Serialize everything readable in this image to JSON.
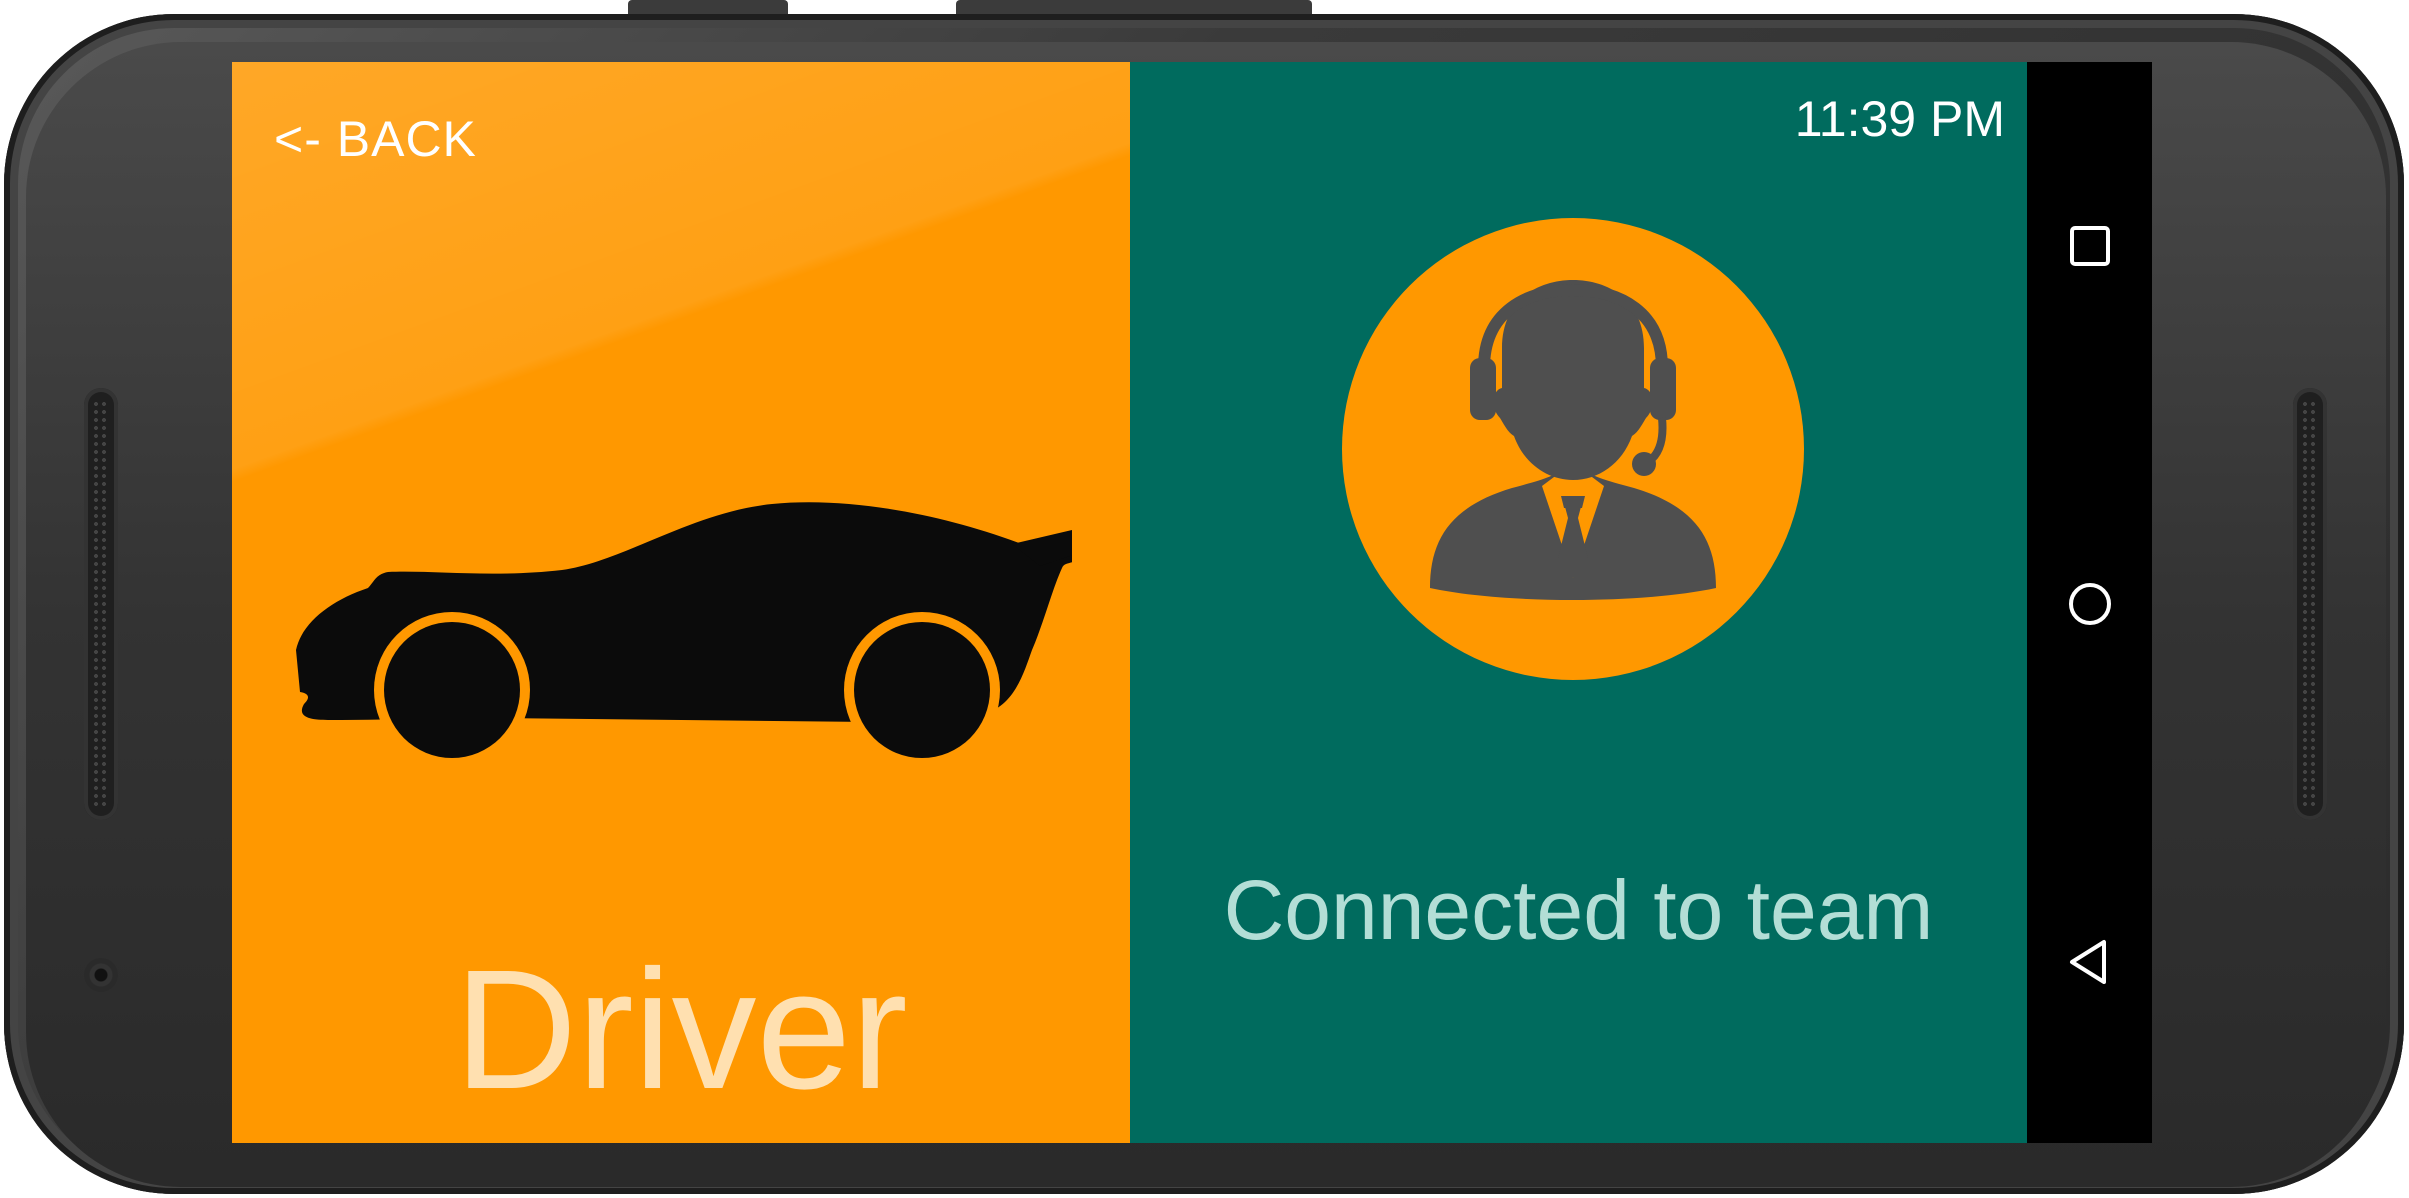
{
  "app": {
    "driver_panel": {
      "back_label": "<- BACK",
      "role_title": "Driver",
      "icon": "race-car-icon",
      "bg_color": "#ff9800"
    },
    "team_panel": {
      "clock": "11:39 PM",
      "status": "Connected to team",
      "icon": "support-agent-headset-icon",
      "bg_color": "#006b5e"
    }
  },
  "nav_bar": {
    "buttons": [
      "recent-apps-icon",
      "home-icon",
      "back-triangle-icon"
    ]
  }
}
